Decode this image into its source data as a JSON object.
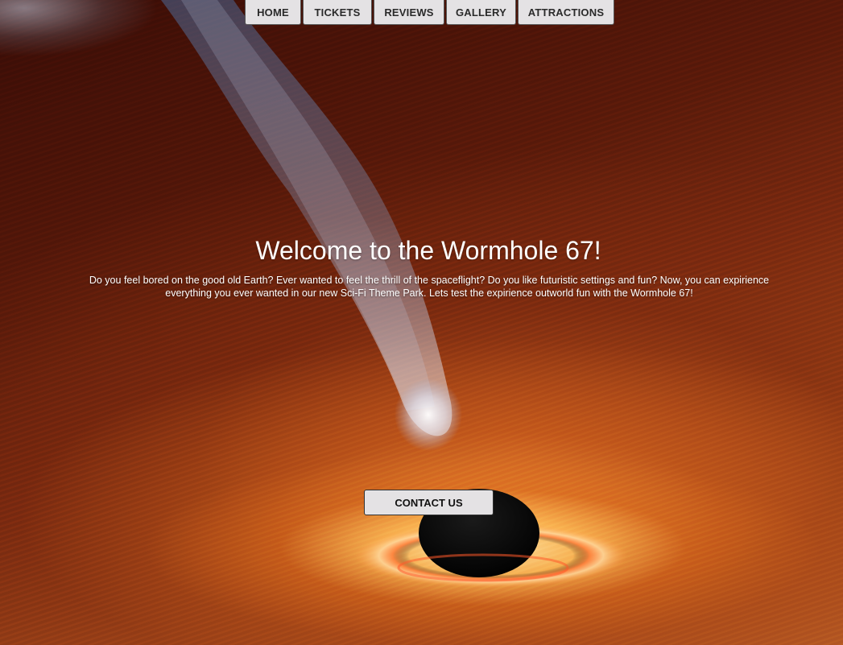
{
  "nav": {
    "items": [
      {
        "label": "HOME"
      },
      {
        "label": "TICKETS"
      },
      {
        "label": "REVIEWS"
      },
      {
        "label": "GALLERY"
      },
      {
        "label": "ATTRACTIONS"
      }
    ]
  },
  "hero": {
    "title": "Welcome to the Wormhole 67!",
    "description": "Do you feel bored on the good old Earth? Ever wanted to feel the thrill of the spaceflight? Do you like futuristic settings and fun? Now, you can expirience everything you ever wanted in our new Sci-Fi Theme Park. Lets test the expirience outworld fun with the Wormhole 67!"
  },
  "contact": {
    "label": "CONTACT US"
  },
  "colors": {
    "button_bg": "#e4e2e4",
    "text_light": "#ffffff",
    "text_dark": "#2a2a2a"
  },
  "background": {
    "image": "black-hole-accretion-disk-with-jet"
  }
}
